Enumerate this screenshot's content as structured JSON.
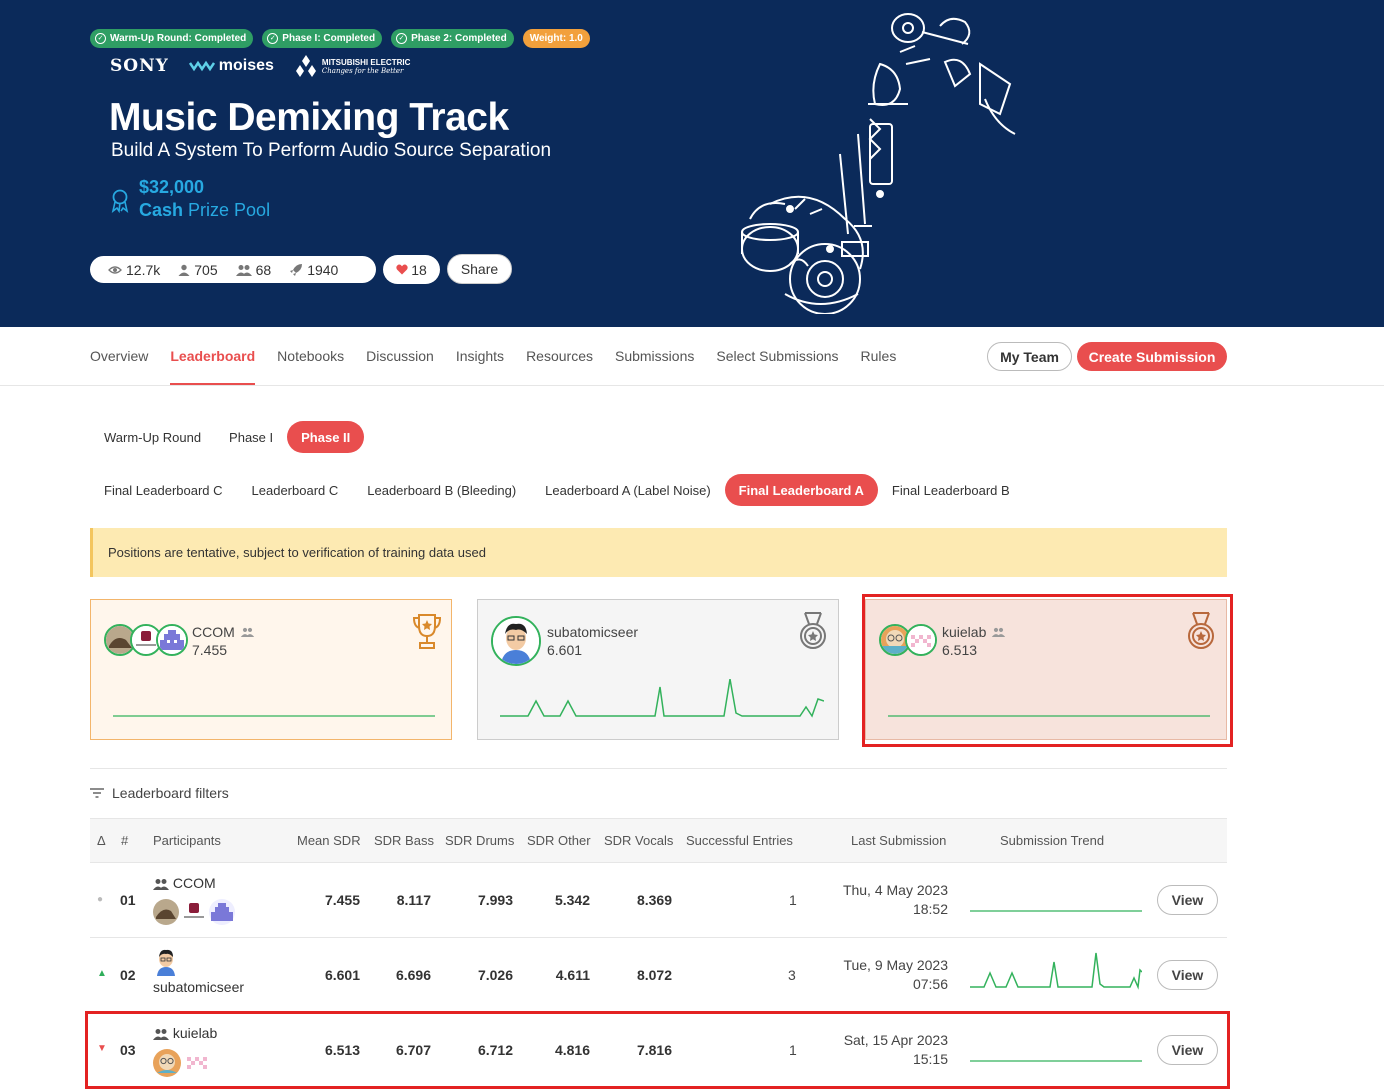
{
  "hero": {
    "badges": [
      {
        "label": "Warm-Up Round: Completed",
        "color": "#2f9e64"
      },
      {
        "label": "Phase I: Completed",
        "color": "#2f9e64"
      },
      {
        "label": "Phase 2: Completed",
        "color": "#2f9e64"
      },
      {
        "label": "Weight: 1.0",
        "color": "#f2a03c"
      }
    ],
    "sponsors": {
      "sony": "SONY",
      "moises": "moises",
      "mitsubishi": "MITSUBISHI ELECTRIC",
      "mitsubishi_tag": "Changes for the Better"
    },
    "title": "Music Demixing Track",
    "subtitle": "Build A System To Perform Audio Source Separation",
    "prize_amount": "$32,000",
    "prize_label_bold": "Cash",
    "prize_label": "Prize Pool",
    "stats": {
      "views": "12.7k",
      "participants": "705",
      "teams": "68",
      "submissions": "1940"
    },
    "likes": "18",
    "share_label": "Share",
    "background": "#0b2a5a"
  },
  "nav": {
    "items": [
      "Overview",
      "Leaderboard",
      "Notebooks",
      "Discussion",
      "Insights",
      "Resources",
      "Submissions",
      "Select Submissions",
      "Rules"
    ],
    "active": "Leaderboard",
    "my_team": "My Team",
    "create": "Create Submission",
    "accent": "#e94e4e"
  },
  "rounds": [
    "Warm-Up Round",
    "Phase I",
    "Phase II"
  ],
  "boards": [
    "Final Leaderboard C",
    "Leaderboard C",
    "Leaderboard B (Bleeding)",
    "Leaderboard A (Label Noise)",
    "Final Leaderboard A",
    "Final Leaderboard B"
  ],
  "notice": "Positions are tentative, subject to verification of training data used",
  "podium": [
    {
      "name": "CCOM",
      "score": "7.455"
    },
    {
      "name": "subatomicseer",
      "score": "6.601"
    },
    {
      "name": "kuielab",
      "score": "6.513"
    }
  ],
  "filters_label": "Leaderboard filters",
  "table": {
    "headers": {
      "delta": "Δ",
      "rank": "#",
      "participants": "Participants",
      "mean": "Mean SDR",
      "bass": "SDR Bass",
      "drums": "SDR Drums",
      "other": "SDR Other",
      "vocals": "SDR Vocals",
      "entries": "Successful Entries",
      "last": "Last Submission",
      "trend": "Submission Trend"
    },
    "rows": [
      {
        "rank": "01",
        "name": "CCOM",
        "mean": "7.455",
        "bass": "8.117",
        "drums": "7.993",
        "other": "5.342",
        "vocals": "8.369",
        "entries": "1",
        "date": "Thu, 4 May 2023",
        "time": "18:52",
        "view": "View"
      },
      {
        "rank": "02",
        "name": "subatomicseer",
        "mean": "6.601",
        "bass": "6.696",
        "drums": "7.026",
        "other": "4.611",
        "vocals": "8.072",
        "entries": "3",
        "date": "Tue, 9 May 2023",
        "time": "07:56",
        "view": "View"
      },
      {
        "rank": "03",
        "name": "kuielab",
        "mean": "6.513",
        "bass": "6.707",
        "drums": "6.712",
        "other": "4.816",
        "vocals": "7.816",
        "entries": "1",
        "date": "Sat, 15 Apr 2023",
        "time": "15:15",
        "view": "View"
      }
    ]
  }
}
